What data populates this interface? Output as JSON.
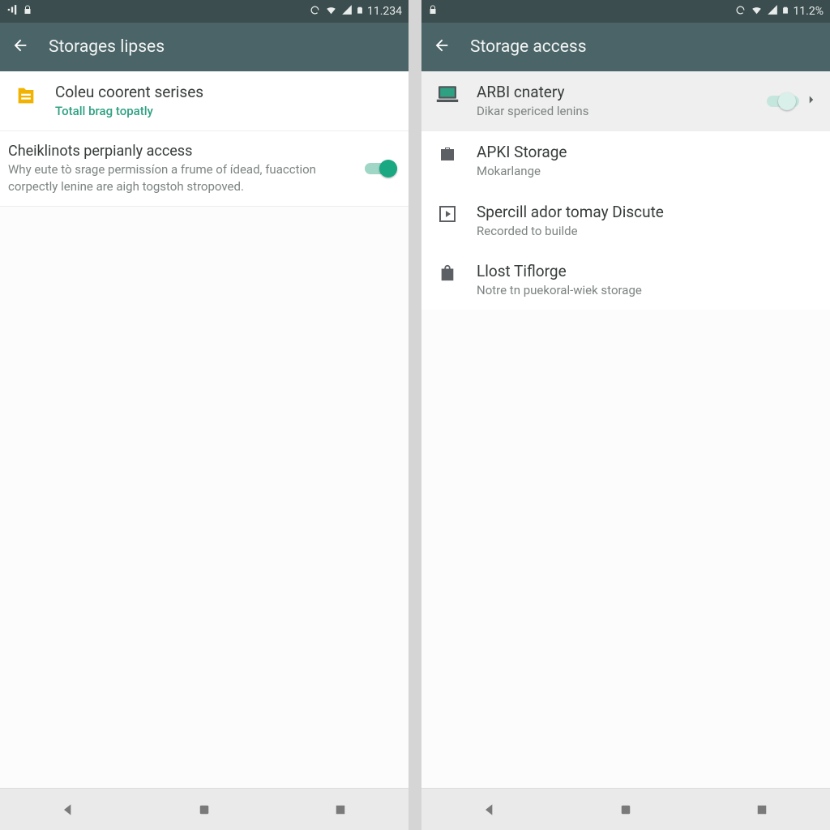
{
  "left": {
    "status": {
      "clock": "11.234"
    },
    "appbar": {
      "title": "Storages lipses"
    },
    "items": [
      {
        "title": "Coleu coorent serises",
        "sub": "Totall brag topatly"
      },
      {
        "title": "Cheiklinots perpianly access",
        "sub": "Why eute tò srage permissíon a frume of ídead, fuacction corpectly lenine are aigh togstoh stropoved."
      }
    ]
  },
  "right": {
    "status": {
      "clock": "11.2%"
    },
    "appbar": {
      "title": "Storage access"
    },
    "items": [
      {
        "title": "ARBI cnatery",
        "sub": "Dikar spericed lenins"
      },
      {
        "title": "APKI Storage",
        "sub": "Mokarlange"
      },
      {
        "title": "Spercill ador tomay Discute",
        "sub": "Recorded to builde"
      },
      {
        "title": "Llost Tiflorge",
        "sub": "Notre tn puekoral-wiek storage"
      }
    ]
  }
}
